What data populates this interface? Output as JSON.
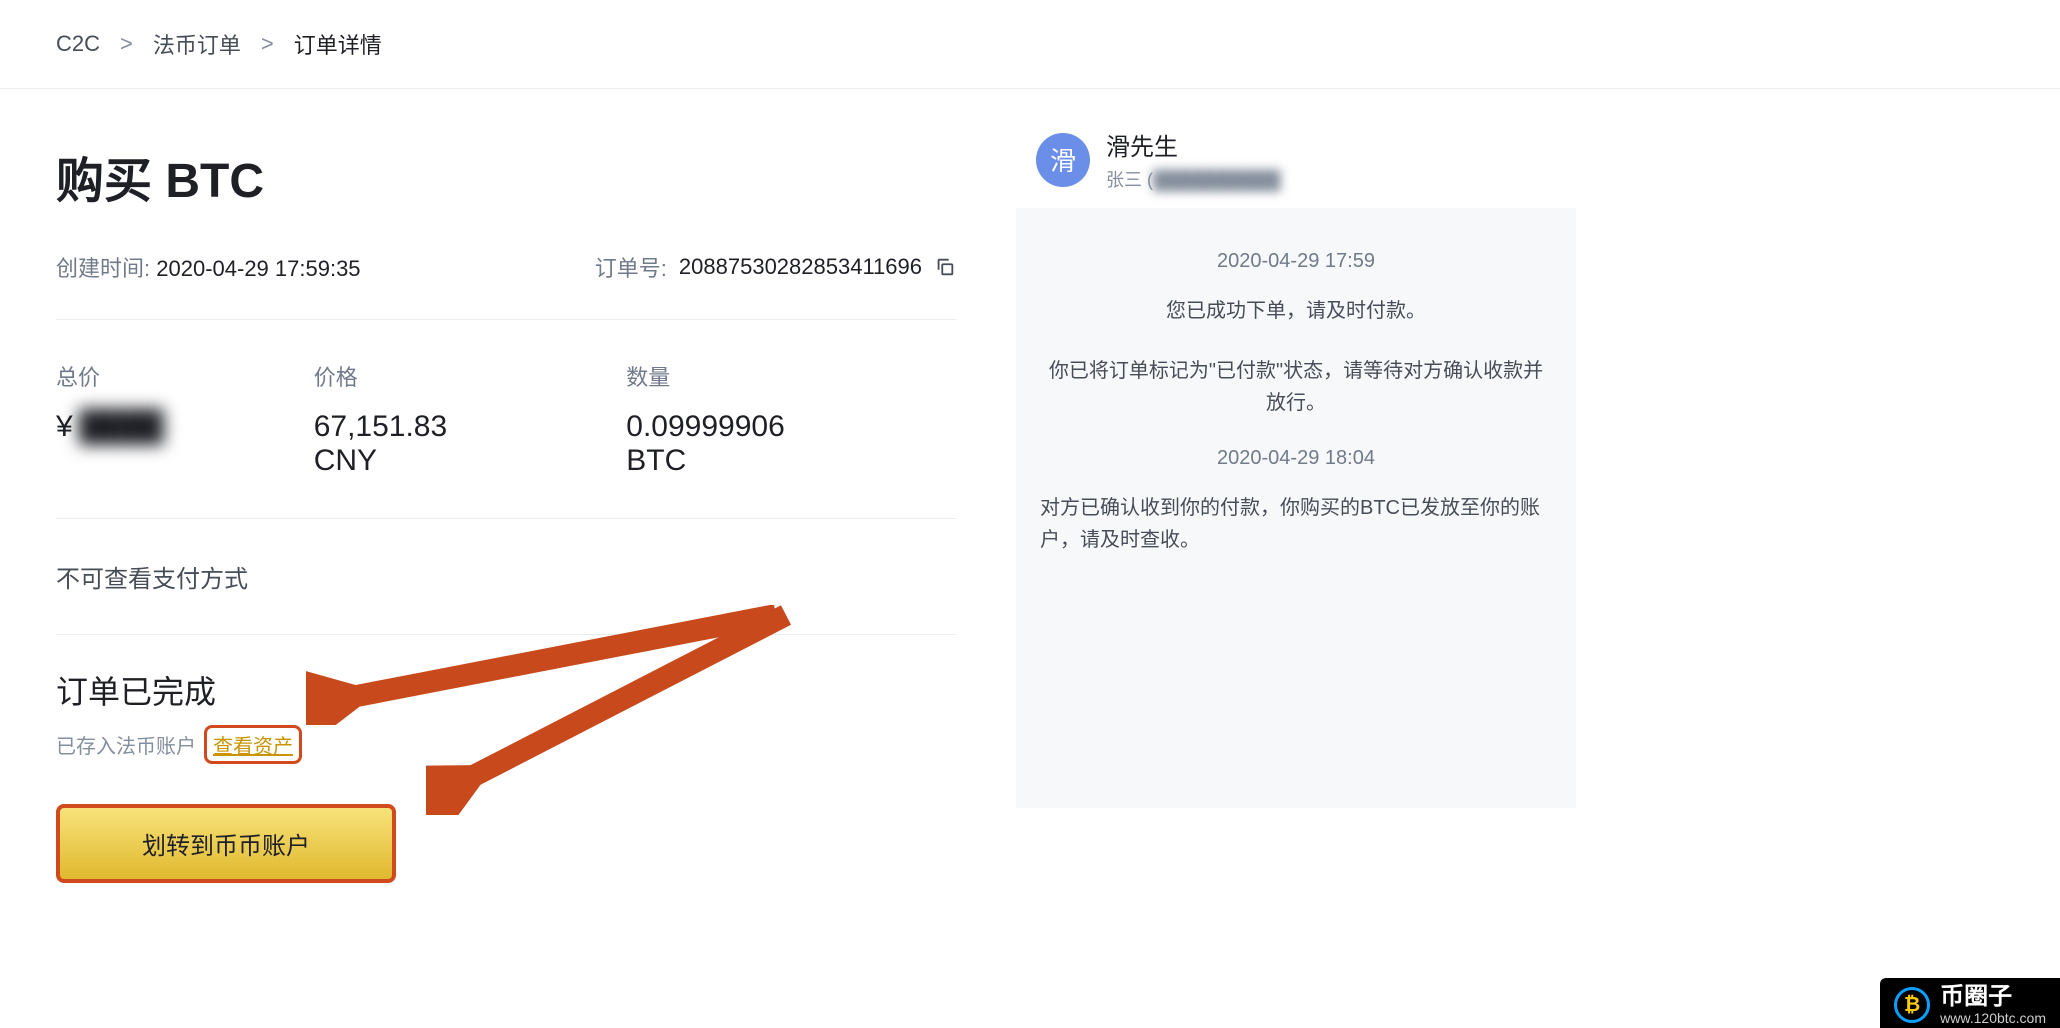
{
  "breadcrumb": {
    "root": "C2C",
    "middle": "法币订单",
    "current": "订单详情"
  },
  "header": {
    "title": "购买 BTC",
    "created_label": "创建时间:",
    "created_value": "2020-04-29 17:59:35",
    "order_no_label": "订单号:",
    "order_no_value": "20887530282853411696"
  },
  "stats": {
    "total_label": "总价",
    "total_symbol": "¥",
    "total_value": "████",
    "price_label": "价格",
    "price_value": "67,151.83 CNY",
    "quantity_label": "数量",
    "quantity_value": "0.09999906 BTC"
  },
  "payment_note": "不可查看支付方式",
  "status": {
    "title": "订单已完成",
    "sub_prefix": "已存入法币账户",
    "view_assets": "查看资产",
    "transfer_button": "划转到币币账户"
  },
  "chat": {
    "avatar_char": "滑",
    "user_name": "滑先生",
    "user_sub_prefix": "张三 (",
    "user_sub_hidden": "██████████",
    "ts1": "2020-04-29 17:59",
    "msg1": "您已成功下单，请及时付款。",
    "msg2": "你已将订单标记为\"已付款\"状态，请等待对方确认收款并放行。",
    "ts2": "2020-04-29 18:04",
    "msg3": "对方已确认收到你的付款，你购买的BTC已发放至你的账户，请及时查收。"
  },
  "watermark": {
    "cn": "币圈子",
    "en": "www.120btc.com"
  }
}
